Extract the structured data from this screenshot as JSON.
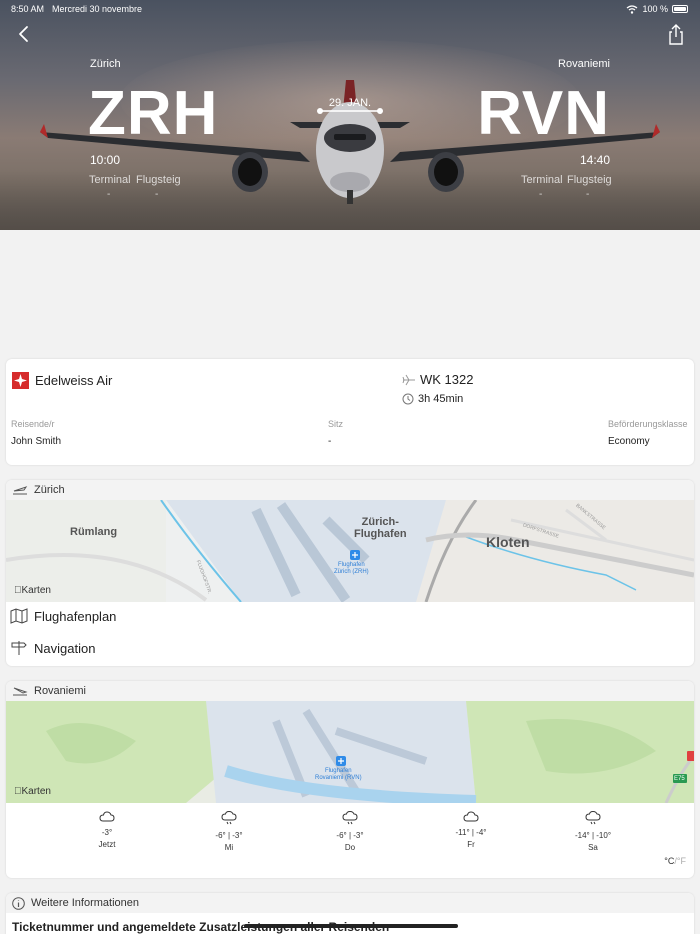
{
  "statusbar": {
    "time": "8:50 AM",
    "date": "Mercredi 30 novembre",
    "battery": "100 %"
  },
  "flight": {
    "from": {
      "city": "Zürich",
      "code": "ZRH",
      "time": "10:00",
      "terminal_label": "Terminal",
      "gate_label": "Flugsteig",
      "terminal": "-",
      "gate": "-"
    },
    "to": {
      "city": "Rovaniemi",
      "code": "RVN",
      "time": "14:40",
      "terminal_label": "Terminal",
      "gate_label": "Flugsteig",
      "terminal": "-",
      "gate": "-"
    },
    "date": "29. JAN."
  },
  "details": {
    "airline": "Edelweiss Air",
    "flight_number": "WK 1322",
    "duration": "3h 45min",
    "passenger_label": "Reisende/r",
    "passenger": "John Smith",
    "seat_label": "Sitz",
    "seat": "-",
    "class_label": "Beförderungsklasse",
    "class": "Economy"
  },
  "departure_airport": {
    "header": "Zürich",
    "map_labels": {
      "rumlang": "Rümlang",
      "zurich_airport": "Zürich-\nFlughafen",
      "kloten": "Kloten",
      "airport_pin": "Flughafen\nZürich (ZRH)",
      "street1": "DORFSTRASSE",
      "street2": "BANKSTRASSE",
      "street3": "FLUGHOFSTR."
    },
    "maps_credit": "Karten",
    "menu": [
      {
        "label": "Flughafenplan",
        "icon": "map-icon"
      },
      {
        "label": "Navigation",
        "icon": "signpost-icon"
      }
    ]
  },
  "arrival_airport": {
    "header": "Rovaniemi",
    "map_labels": {
      "airport_pin": "Flughafen\nRovaniemi (RVN)",
      "road": "E75"
    },
    "maps_credit": "Karten",
    "weather": [
      {
        "temp": "-3°",
        "day": "Jetzt",
        "icon": "cloud-icon"
      },
      {
        "temp": "-6° | -3°",
        "day": "Mi",
        "icon": "cloud-snow-icon"
      },
      {
        "temp": "-6° | -3°",
        "day": "Do",
        "icon": "cloud-snow-icon"
      },
      {
        "temp": "-11° | -4°",
        "day": "Fr",
        "icon": "cloud-icon"
      },
      {
        "temp": "-14° | -10°",
        "day": "Sa",
        "icon": "cloud-snow-icon"
      }
    ],
    "unit_c": "°C",
    "unit_sep": "/",
    "unit_f": "°F"
  },
  "more_info": {
    "header": "Weitere Informationen",
    "ticket_text": "Ticketnummer und angemeldete Zusatzleistungen aller Reisenden"
  },
  "colors": {
    "airline_red": "#d62b2b",
    "map_green": "#c9e2b1",
    "map_water": "#9fd2ec"
  }
}
